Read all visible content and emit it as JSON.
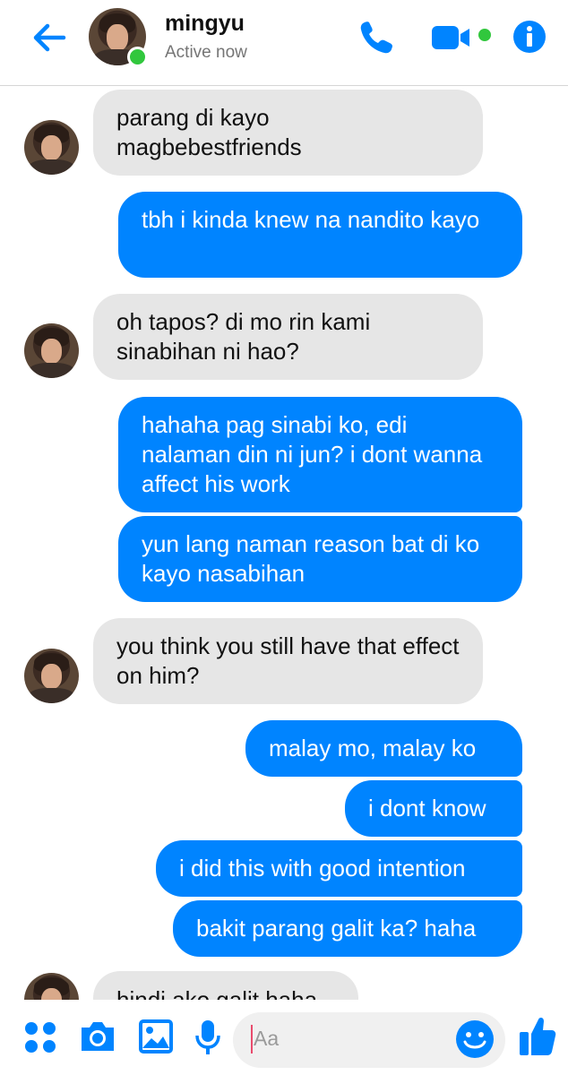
{
  "header": {
    "contact_name": "mingyu",
    "status": "Active now",
    "icons": [
      "back-arrow-icon",
      "phone-icon",
      "video-camera-icon",
      "info-icon"
    ],
    "accent": "#0084ff",
    "online_color": "#31c73d"
  },
  "messages": [
    {
      "dir": "in",
      "text": "parang di kayo magbebestfriends"
    },
    {
      "dir": "out",
      "text": "tbh i kinda knew na nandito kayo"
    },
    {
      "dir": "in",
      "text": "oh tapos? di mo rin kami sinabihan ni hao?"
    },
    {
      "dir": "out",
      "text": "hahaha pag sinabi ko, edi nalaman din ni jun? i dont wanna affect his work"
    },
    {
      "dir": "out",
      "text": "yun lang naman reason bat di ko kayo nasabihan"
    },
    {
      "dir": "in",
      "text": "you think you still have that effect on him?"
    },
    {
      "dir": "out",
      "text": "malay mo, malay ko"
    },
    {
      "dir": "out",
      "text": "i dont know"
    },
    {
      "dir": "out",
      "text": "i did this with good intention"
    },
    {
      "dir": "out",
      "text": "bakit parang galit ka? haha"
    },
    {
      "dir": "in",
      "text": "hindi ako galit haha"
    }
  ],
  "composer": {
    "placeholder": "Aa",
    "icons": [
      "apps-grid-icon",
      "camera-icon",
      "image-icon",
      "microphone-icon",
      "emoji-icon",
      "thumbs-up-icon"
    ]
  }
}
